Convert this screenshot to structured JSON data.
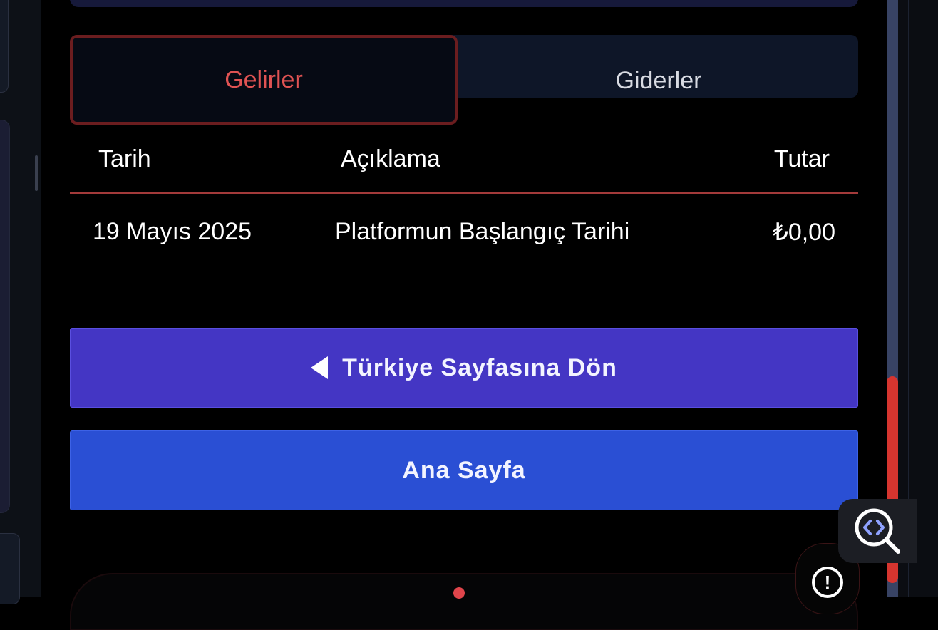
{
  "tabs": {
    "income_label": "Gelirler",
    "expense_label": "Giderler",
    "active": "income"
  },
  "table": {
    "headers": {
      "date": "Tarih",
      "description": "Açıklama",
      "amount": "Tutar"
    },
    "rows": [
      {
        "date": "19 Mayıs 2025",
        "description": "Platformun Başlangıç Tarihi",
        "amount": "₺0,00"
      }
    ]
  },
  "buttons": {
    "back_label": "Türkiye Sayfasına Dön",
    "home_label": "Ana Sayfa"
  },
  "alert": {
    "symbol": "!"
  },
  "icons": {
    "back": "caret-left-icon",
    "alert": "alert-circle-icon",
    "inspect": "code-search-icon"
  },
  "colors": {
    "active_tab_text": "#e05353",
    "active_tab_border": "#6b1d1f",
    "back_button": "#4436c4",
    "home_button": "#2a4fd4",
    "scroll_thumb": "#d6352f"
  }
}
